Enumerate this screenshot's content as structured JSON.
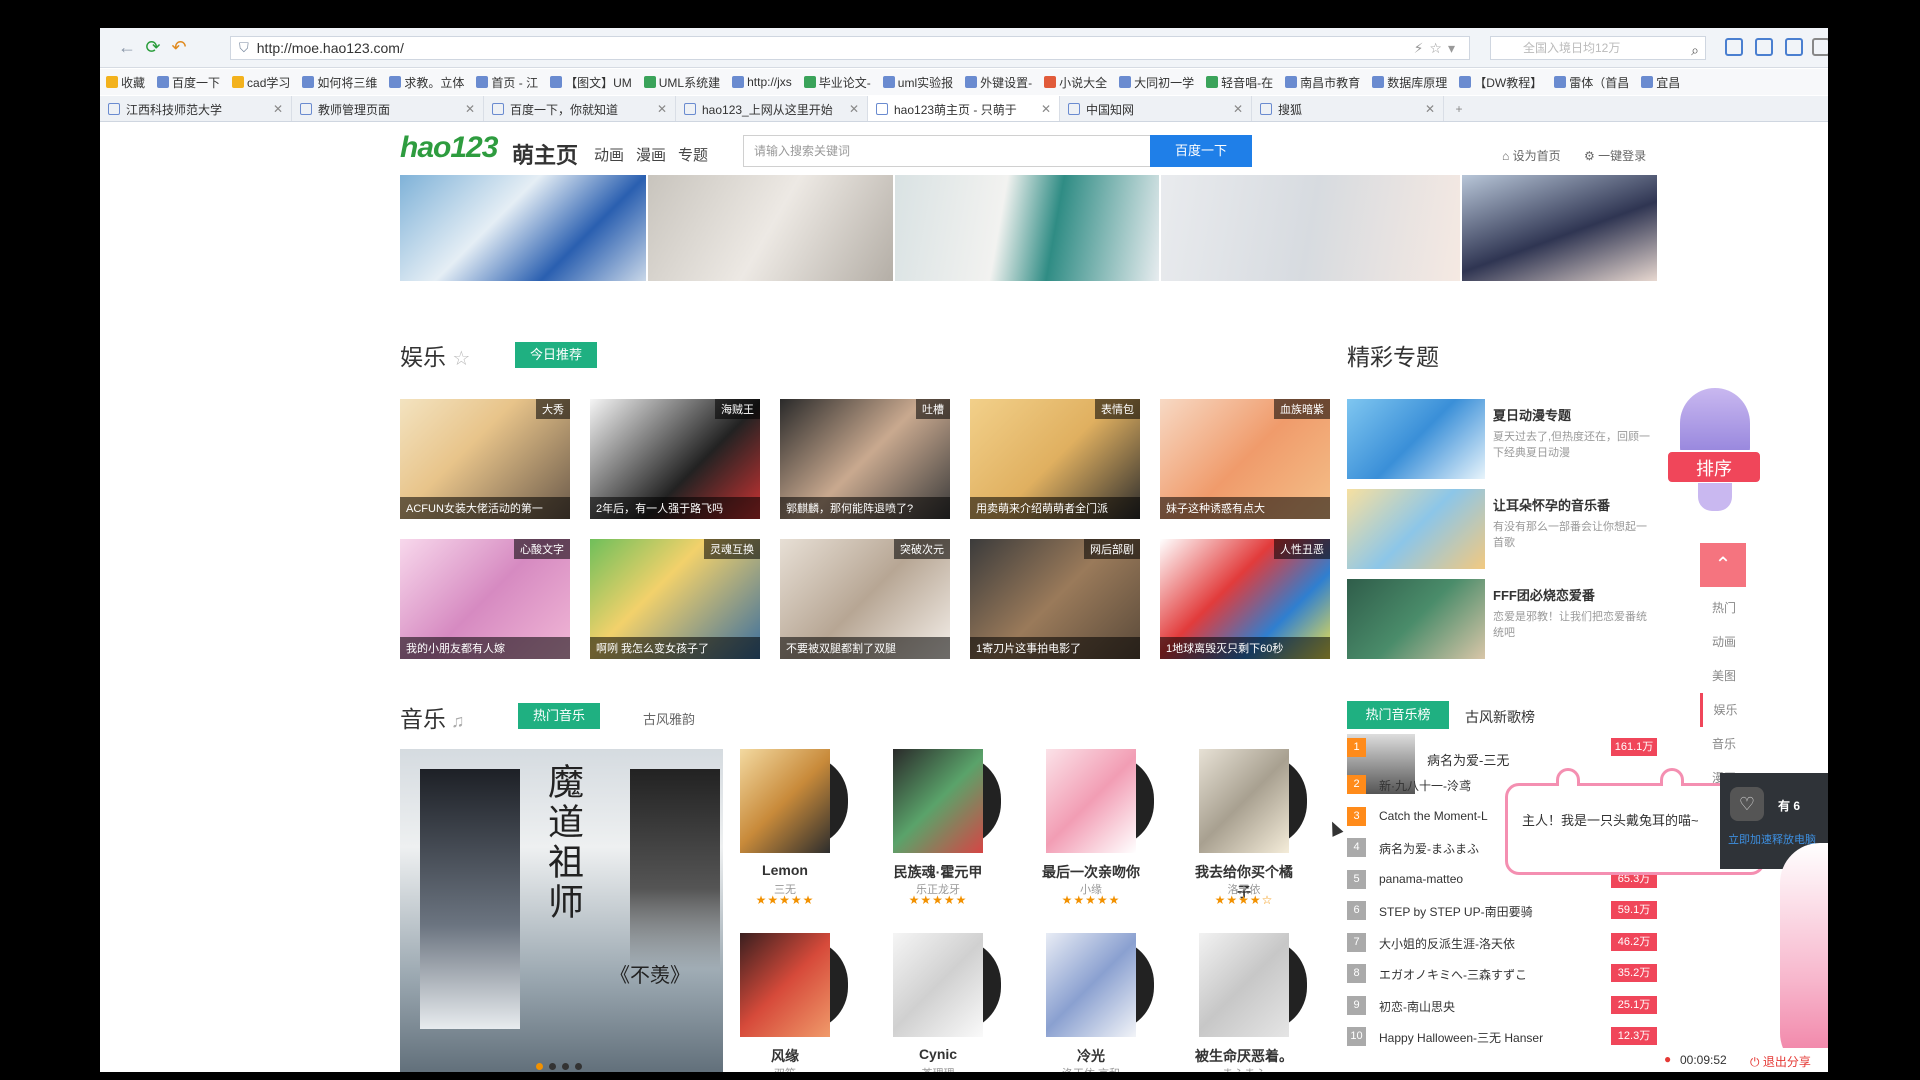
{
  "browser": {
    "url": "http://moe.hao123.com/",
    "search_placeholder": "全国入境日均12万",
    "favorites": [
      "收藏",
      "百度一下",
      "cad学习",
      "如何将三维",
      "求教。立体",
      "首页 - 江",
      "【图文】UM",
      "UML系统建",
      "http://jxs",
      "毕业论文-",
      "uml实验报",
      "外键设置-",
      "小说大全",
      "大同初一学",
      "轻音唱-在",
      "南昌市教育",
      "数据库原理",
      "【DW教程】",
      "雷体（首昌",
      "宜昌"
    ],
    "tabs": [
      {
        "label": "江西科技师范大学",
        "active": false
      },
      {
        "label": "教师管理页面",
        "active": false
      },
      {
        "label": "百度一下，你就知道",
        "active": false
      },
      {
        "label": "hao123_上网从这里开始",
        "active": false
      },
      {
        "label": "hao123萌主页 - 只萌于",
        "active": true
      },
      {
        "label": "中国知网",
        "active": false
      },
      {
        "label": "搜狐",
        "active": false
      }
    ]
  },
  "header": {
    "logo": "hao123",
    "subtitle": "萌主页",
    "nav": [
      "动画",
      "漫画",
      "专题"
    ],
    "search_placeholder": "请输入搜索关键词",
    "search_button": "百度一下",
    "set_home": "设为首页",
    "login": "一键登录"
  },
  "entertainment": {
    "title": "娱乐",
    "badge": "今日推荐",
    "tiles": [
      {
        "tag": "大秀",
        "caption": "ACFUN女装大佬活动的第一"
      },
      {
        "tag": "海贼王",
        "caption": "2年后，有一人强于路飞吗"
      },
      {
        "tag": "吐槽",
        "caption": "郭麒麟，那何能阵退喷了?"
      },
      {
        "tag": "表情包",
        "caption": "用卖萌来介绍萌萌者全门派"
      },
      {
        "tag": "血族暗紫",
        "caption": "妹子这种诱惑有点大"
      },
      {
        "tag": "心酸文字",
        "caption": "我的小朋友都有人嫁"
      },
      {
        "tag": "灵魂互换",
        "caption": "啊咧 我怎么变女孩子了"
      },
      {
        "tag": "突破次元",
        "caption": "不要被双腿都割了双腿"
      },
      {
        "tag": "网后部剧",
        "caption": "1寄刀片这事拍电影了"
      },
      {
        "tag": "人性丑恶",
        "caption": "1地球离毁灭只剩下60秒"
      }
    ]
  },
  "topics": {
    "title": "精彩专题",
    "items": [
      {
        "title": "夏日动漫专题",
        "desc": "夏天过去了,但热度还在，回顾一下经典夏日动漫"
      },
      {
        "title": "让耳朵怀孕的音乐番",
        "desc": "有没有那么一部番会让你想起一首歌"
      },
      {
        "title": "FFF团必烧恋爱番",
        "desc": "恋爱是邪教！让我们把恋爱番统统吧"
      }
    ]
  },
  "music": {
    "title": "音乐",
    "tab_active": "热门音乐",
    "tab_other": "古风雅韵",
    "feature_title": "魔道祖师",
    "feature_sub": "《不羡》",
    "albums": [
      {
        "name": "Lemon",
        "artist": "三无",
        "stars": "★★★★★"
      },
      {
        "name": "民族魂·霍元甲",
        "artist": "乐正龙牙",
        "stars": "★★★★★"
      },
      {
        "name": "最后一次亲吻你",
        "artist": "小缘",
        "stars": "★★★★★"
      },
      {
        "name": "我去给你买个橘子",
        "artist": "洛天依",
        "stars": "★★★★☆"
      },
      {
        "name": "风缘",
        "artist": "双笙",
        "stars": "★★★★★"
      },
      {
        "name": "Cynic",
        "artist": "茶理理",
        "stars": "★★★★★"
      },
      {
        "name": "冷光",
        "artist": "洛天依 言和",
        "stars": "★★★★★"
      },
      {
        "name": "被生命厌恶着。",
        "artist": "まふまふ",
        "stars": "★★★★★"
      }
    ]
  },
  "ranking": {
    "tab_active": "热门音乐榜",
    "tab_other": "古风新歌榜",
    "rows": [
      {
        "no": "1",
        "song": "病名为爱-三无",
        "count": "161.1万"
      },
      {
        "no": "2",
        "song": "新·九八十一-泠鸢",
        "count": ""
      },
      {
        "no": "3",
        "song": "Catch the Moment-L",
        "count": ""
      },
      {
        "no": "4",
        "song": "病名为爱-まふまふ",
        "count": ""
      },
      {
        "no": "5",
        "song": "panama-matteo",
        "count": "65.3万"
      },
      {
        "no": "6",
        "song": "STEP by STEP UP-南田要骑",
        "count": "59.1万"
      },
      {
        "no": "7",
        "song": "大小姐的反派生涯-洛天依",
        "count": "46.2万"
      },
      {
        "no": "8",
        "song": "エガオノキミへ-三森すずこ",
        "count": "35.2万"
      },
      {
        "no": "9",
        "song": "初恋-南山思央",
        "count": "25.1万"
      },
      {
        "no": "10",
        "song": "Happy Halloween-三无 Hanser",
        "count": "12.3万"
      }
    ]
  },
  "side": {
    "rank_label": "排序",
    "nav": [
      "热门",
      "动画",
      "美图",
      "娱乐",
      "音乐",
      "漫画"
    ],
    "bubble": "主人！我是一只头戴兔耳的喵~",
    "share_count": "有 6",
    "share_link": "立即加速释放电脑",
    "timer": "00:09:52",
    "exit_share": "退出分享"
  },
  "colors": {
    "accent_green": "#1fb081",
    "search_blue": "#1f7fe8",
    "rank_red": "#f0465a",
    "rank_orange": "#ff8b1a"
  }
}
